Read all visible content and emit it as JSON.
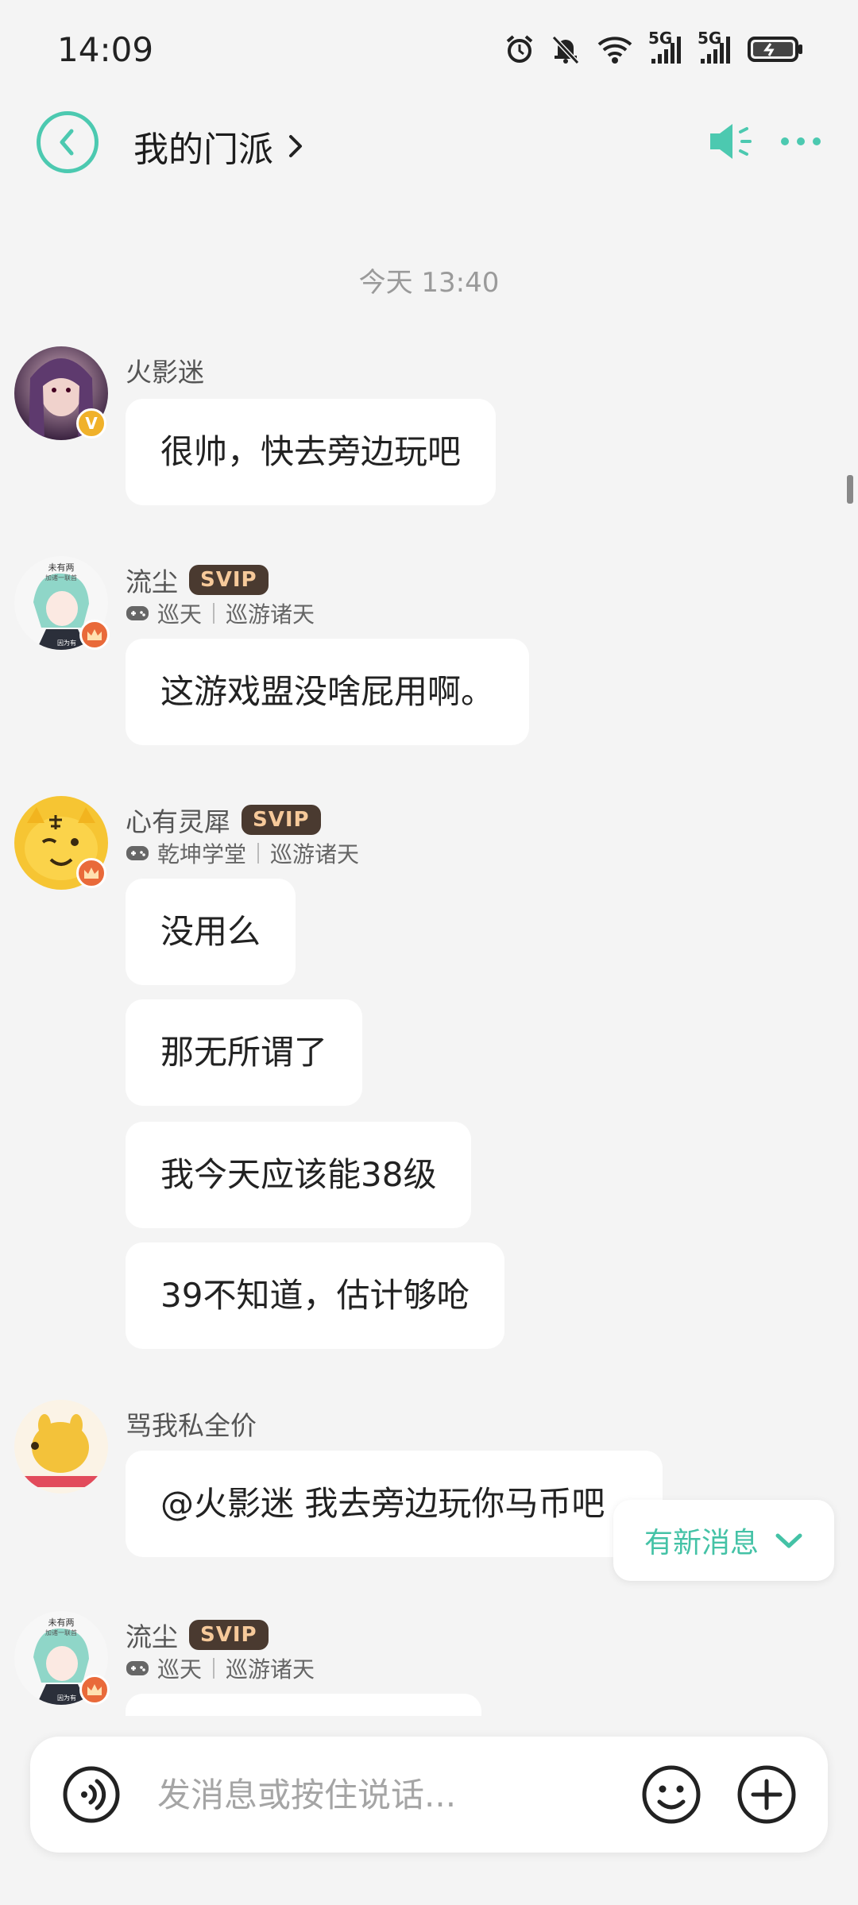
{
  "status_bar": {
    "time": "14:09",
    "sim1": "5G",
    "sim2": "5G"
  },
  "header": {
    "title": "我的门派",
    "accent": "#4cc9b0"
  },
  "chat": {
    "timestamp": "今天 13:40",
    "groups": [
      {
        "name": "火影迷",
        "badge": "V",
        "messages": [
          "很帅，快去旁边玩吧"
        ]
      },
      {
        "name": "流尘",
        "svip": "SVIP",
        "tag1": "巡天",
        "tag2": "巡游诸天",
        "messages": [
          "这游戏盟没啥屁用啊。"
        ]
      },
      {
        "name": "心有灵犀",
        "svip": "SVIP",
        "tag1": "乾坤学堂",
        "tag2": "巡游诸天",
        "messages": [
          "没用么",
          "那无所谓了",
          "我今天应该能38级",
          "39不知道，估计够呛"
        ]
      },
      {
        "name": "骂我私全价",
        "messages": [
          "@火影迷 我去旁边玩你马币吧"
        ]
      },
      {
        "name": "流尘",
        "svip": "SVIP",
        "tag1": "巡天",
        "tag2": "巡游诸天",
        "messages": [
          ""
        ]
      }
    ],
    "avatar_text": {
      "liuchen_top": "未有两",
      "liuchen_mid": "加诸一联首",
      "liuchen_bottom": "因为有"
    },
    "new_message": "有新消息"
  },
  "input": {
    "placeholder": "发消息或按住说话..."
  }
}
